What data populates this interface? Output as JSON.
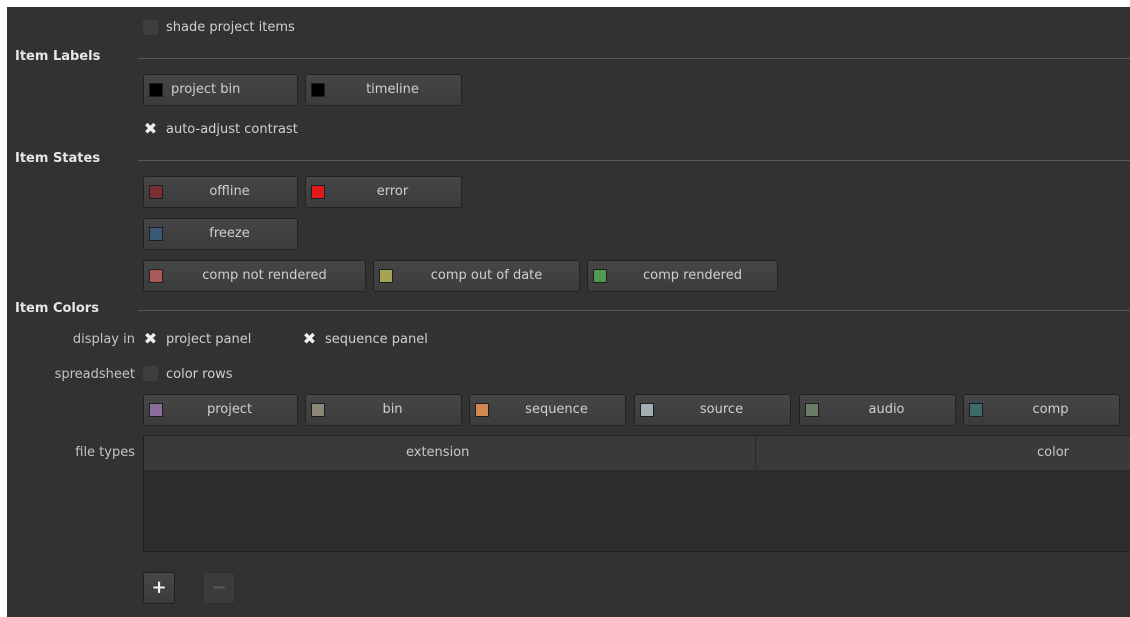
{
  "shade": {
    "label": "shade project items",
    "checked": false
  },
  "item_labels": {
    "title": "Item Labels",
    "buttons": [
      {
        "label": "project bin",
        "color": "#000000"
      },
      {
        "label": "timeline",
        "color": "#000000"
      }
    ],
    "auto_adjust": {
      "label": "auto-adjust contrast",
      "checked": true
    }
  },
  "item_states": {
    "title": "Item States",
    "buttons": [
      {
        "label": "offline",
        "color": "#7a2f30"
      },
      {
        "label": "error",
        "color": "#e01a1a"
      },
      {
        "label": "freeze",
        "color": "#3a5878"
      },
      {
        "label": "comp not rendered",
        "color": "#a85a5a"
      },
      {
        "label": "comp out of date",
        "color": "#a6a354"
      },
      {
        "label": "comp rendered",
        "color": "#4f9a50"
      }
    ]
  },
  "item_colors": {
    "title": "Item Colors",
    "display_in": {
      "label": "display in",
      "project_panel": {
        "label": "project panel",
        "checked": true
      },
      "sequence_panel": {
        "label": "sequence panel",
        "checked": true
      }
    },
    "spreadsheet": {
      "label": "spreadsheet",
      "color_rows": {
        "label": "color rows",
        "checked": false
      }
    },
    "buttons": [
      {
        "label": "project",
        "color": "#8a6e9c"
      },
      {
        "label": "bin",
        "color": "#8c8678"
      },
      {
        "label": "sequence",
        "color": "#d08850"
      },
      {
        "label": "source",
        "color": "#a4acb4"
      },
      {
        "label": "audio",
        "color": "#6a7c66"
      },
      {
        "label": "comp",
        "color": "#3c6a68"
      }
    ],
    "file_types": {
      "label": "file types",
      "columns": [
        "extension",
        "color"
      ],
      "rows": []
    }
  },
  "actions": {
    "add": "+",
    "remove": "−"
  }
}
